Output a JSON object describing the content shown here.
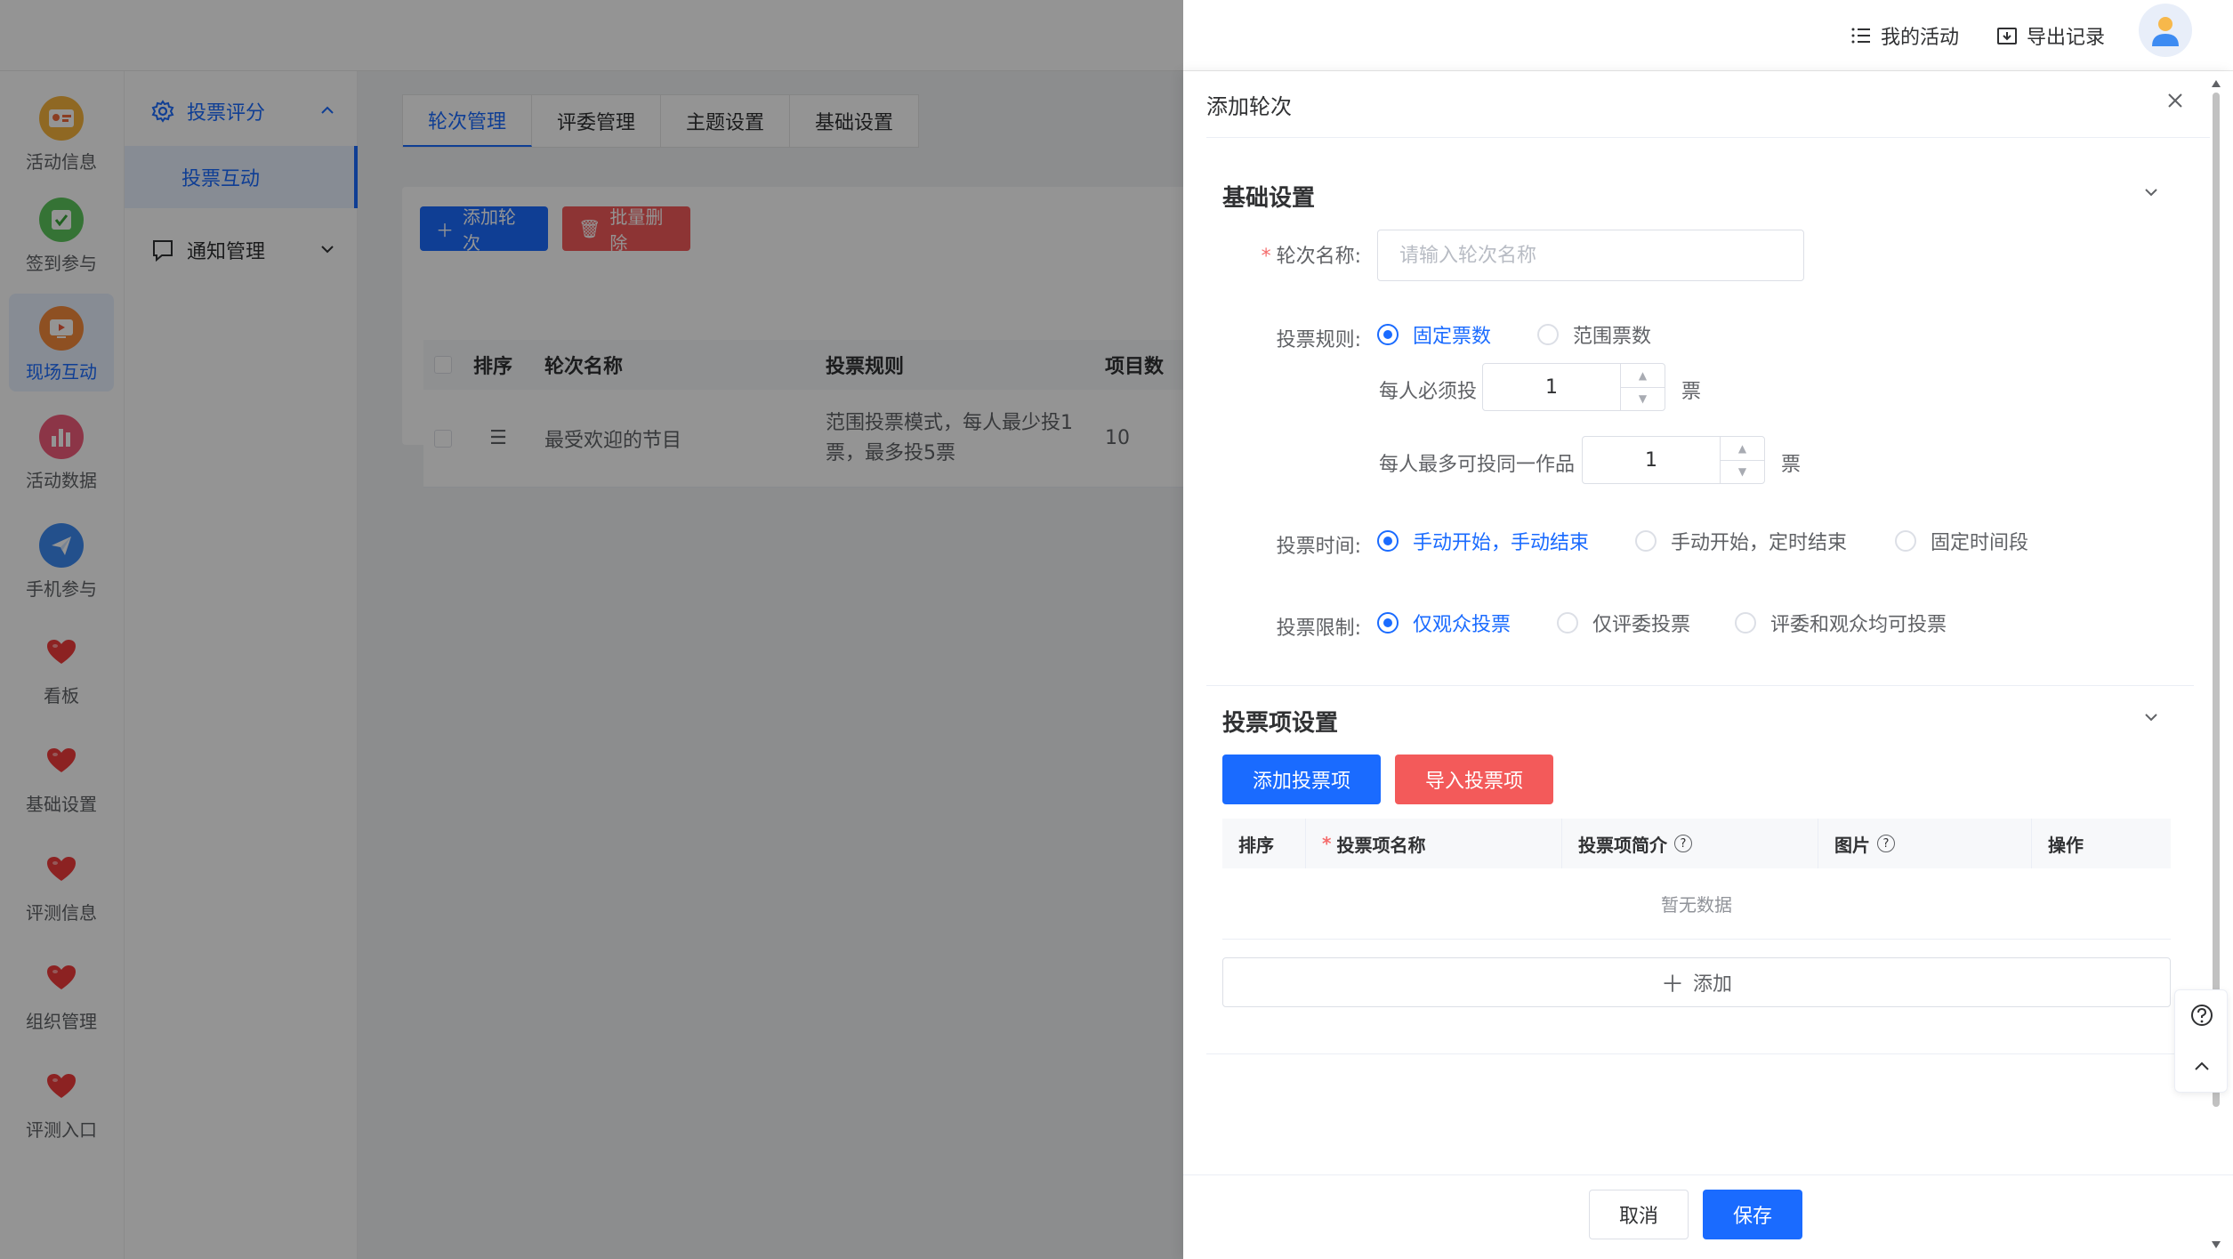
{
  "header": {
    "my_activity": "我的活动",
    "export_records": "导出记录"
  },
  "rail": {
    "items": [
      {
        "label": "活动信息",
        "color": "#f6b43d"
      },
      {
        "label": "签到参与",
        "color": "#5cc65c"
      },
      {
        "label": "现场互动",
        "color": "#f58a3c"
      },
      {
        "label": "活动数据",
        "color": "#f25c7a"
      },
      {
        "label": "手机参与",
        "color": "#3d8bf2"
      },
      {
        "label": "看板",
        "color": "#f23c3c"
      },
      {
        "label": "基础设置",
        "color": "#f23c3c"
      },
      {
        "label": "评测信息",
        "color": "#f23c3c"
      },
      {
        "label": "组织管理",
        "color": "#f23c3c"
      },
      {
        "label": "评测入口",
        "color": "#f23c3c"
      }
    ]
  },
  "submenu": {
    "group1": "投票评分",
    "group1_item": "投票互动",
    "group2": "通知管理"
  },
  "main": {
    "tabs": [
      "轮次管理",
      "评委管理",
      "主题设置",
      "基础设置"
    ],
    "add_round": "添加轮次",
    "batch_delete": "批量删除",
    "columns": [
      "排序",
      "轮次名称",
      "投票规则",
      "项目数"
    ],
    "row": {
      "name": "最受欢迎的节目",
      "rule": "范围投票模式，每人最少投1票，最多投5票",
      "count": "10"
    }
  },
  "drawer": {
    "title": "添加轮次",
    "basic_section": "基础设置",
    "round_name_label": "轮次名称:",
    "round_name_placeholder": "请输入轮次名称",
    "vote_rule_label": "投票规则:",
    "vote_rule_options": [
      "固定票数",
      "范围票数"
    ],
    "must_vote_label": "每人必须投",
    "must_vote_value": "1",
    "max_same_label": "每人最多可投同一作品",
    "max_same_value": "1",
    "unit": "票",
    "vote_time_label": "投票时间:",
    "vote_time_options": [
      "手动开始，手动结束",
      "手动开始，定时结束",
      "固定时间段"
    ],
    "vote_limit_label": "投票限制:",
    "vote_limit_options": [
      "仅观众投票",
      "仅评委投票",
      "评委和观众均可投票"
    ],
    "items_section": "投票项设置",
    "add_item": "添加投票项",
    "import_item": "导入投票项",
    "item_columns": [
      "排序",
      "投票项名称",
      "投票项简介",
      "图片",
      "操作"
    ],
    "empty": "暂无数据",
    "add": "添加",
    "cancel": "取消",
    "save": "保存"
  },
  "colors": {
    "primary": "#1a6bff",
    "danger": "#f35a5a"
  }
}
